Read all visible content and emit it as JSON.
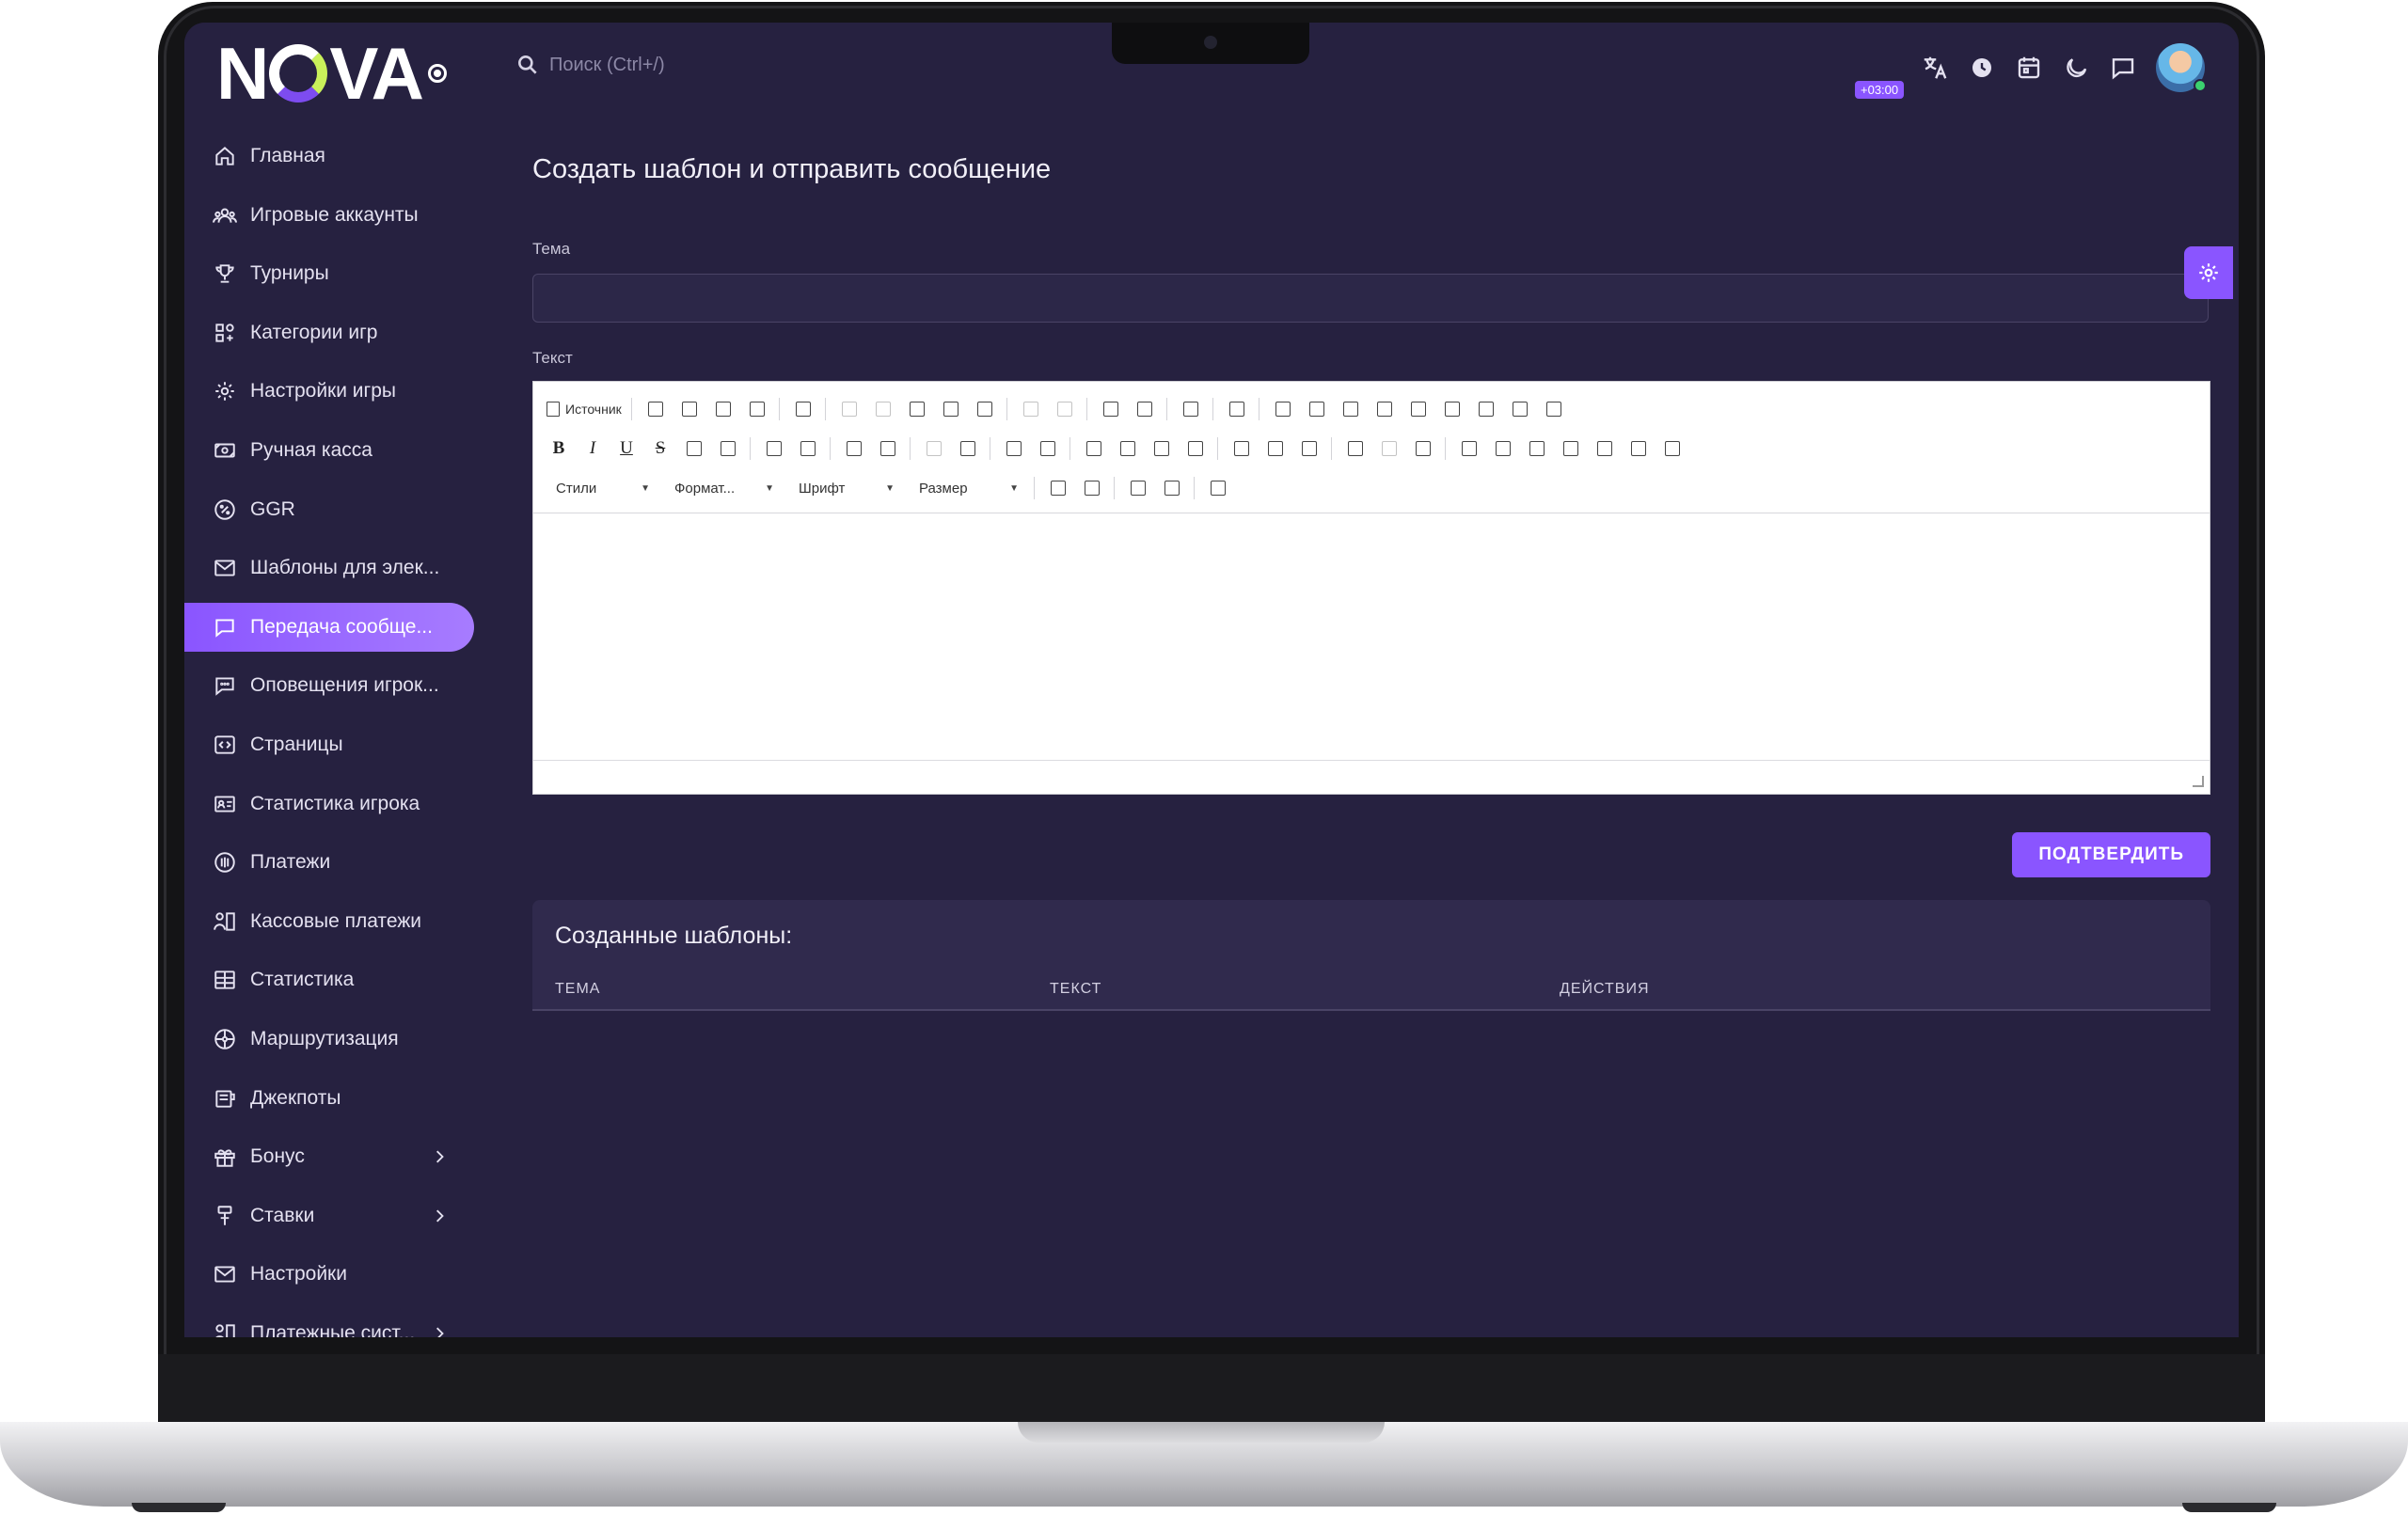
{
  "brand": {
    "logo_pre": "N",
    "logo_post": "VA"
  },
  "search": {
    "placeholder": "Поиск (Ctrl+/)"
  },
  "topbar": {
    "timezone_badge": "+03:00"
  },
  "sidebar": {
    "items": [
      {
        "label": "Главная",
        "icon": "home-icon"
      },
      {
        "label": "Игровые аккаунты",
        "icon": "users-icon"
      },
      {
        "label": "Турниры",
        "icon": "trophy-icon"
      },
      {
        "label": "Категории игр",
        "icon": "category-icon"
      },
      {
        "label": "Настройки игры",
        "icon": "gear-icon"
      },
      {
        "label": "Ручная касса",
        "icon": "cash-icon"
      },
      {
        "label": "GGR",
        "icon": "percent-icon"
      },
      {
        "label": "Шаблоны для элек...",
        "icon": "mail-icon"
      },
      {
        "label": "Передача сообще...",
        "icon": "message-icon",
        "active": true
      },
      {
        "label": "Оповещения игрок...",
        "icon": "chat-icon"
      },
      {
        "label": "Страницы",
        "icon": "code-icon"
      },
      {
        "label": "Статистика игрока",
        "icon": "id-card-icon"
      },
      {
        "label": "Платежи",
        "icon": "coin-icon"
      },
      {
        "label": "Кассовые платежи",
        "icon": "cashier-icon"
      },
      {
        "label": "Статистика",
        "icon": "table-icon"
      },
      {
        "label": "Маршрутизация",
        "icon": "route-icon"
      },
      {
        "label": "Джекпоты",
        "icon": "jackpot-icon"
      },
      {
        "label": "Бонус",
        "icon": "gift-icon",
        "expandable": true
      },
      {
        "label": "Ставки",
        "icon": "bet-icon",
        "expandable": true
      },
      {
        "label": "Настройки",
        "icon": "mail-icon"
      },
      {
        "label": "Платежные сист...",
        "icon": "cashier-icon",
        "expandable": true
      }
    ]
  },
  "main": {
    "title": "Создать шаблон и отправить сообщение",
    "subject_label": "Тема",
    "subject_value": "",
    "text_label": "Текст",
    "editor": {
      "source_label": "Источник",
      "styles_label": "Стили",
      "format_label": "Формат...",
      "font_label": "Шрифт",
      "size_label": "Размер"
    },
    "submit_label": "ПОДТВЕРДИТЬ",
    "templates": {
      "title": "Созданные шаблоны:",
      "columns": [
        "ТЕМА",
        "ТЕКСТ",
        "ДЕЙСТВИЯ"
      ]
    }
  }
}
